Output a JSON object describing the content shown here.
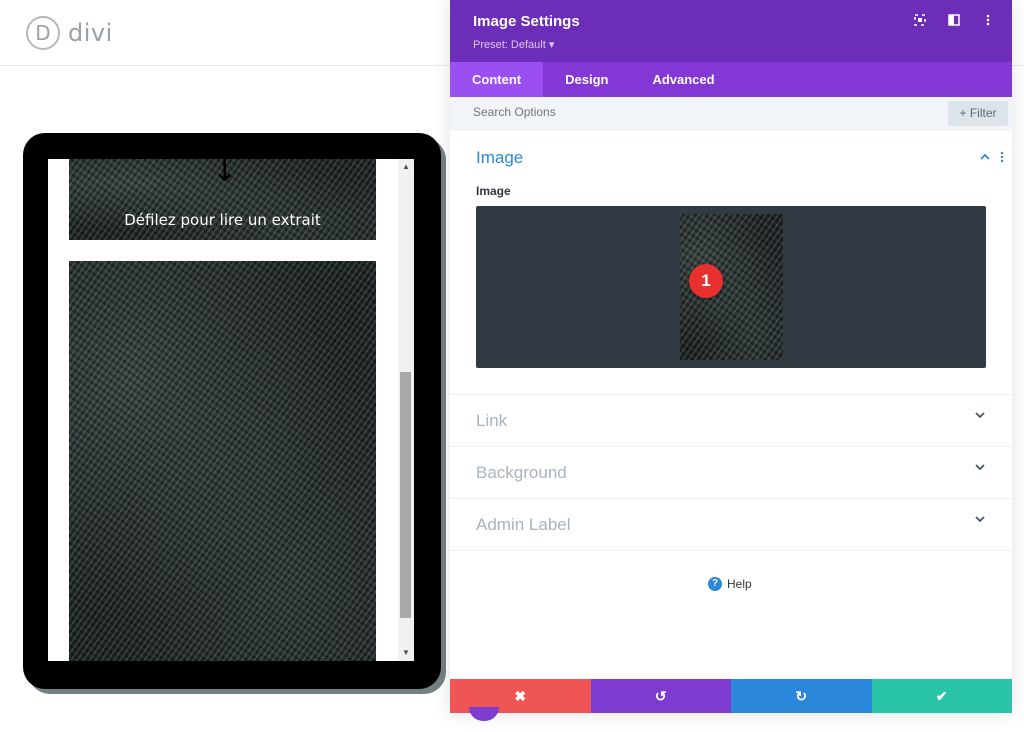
{
  "app": {
    "logo_text": "divi",
    "logo_mark": "D"
  },
  "preview": {
    "scroll_arrow_icon": "arrow-down-icon",
    "hero_text": "Défilez pour lire un extrait",
    "scrollbar_up": "▲",
    "scrollbar_down": "▼"
  },
  "panel": {
    "title": "Image Settings",
    "preset": "Preset: Default ▾",
    "header_icons": [
      "screenshot-icon",
      "sidebar-toggle-icon",
      "more-icon"
    ],
    "tabs": [
      {
        "label": "Content",
        "active": true
      },
      {
        "label": "Design",
        "active": false
      },
      {
        "label": "Advanced",
        "active": false
      }
    ],
    "search": {
      "placeholder": "Search Options"
    },
    "filter_label": "+ Filter",
    "image_section": {
      "title": "Image",
      "field_label": "Image",
      "badge": "1"
    },
    "collapsed_sections": [
      {
        "label": "Link"
      },
      {
        "label": "Background"
      },
      {
        "label": "Admin Label"
      }
    ],
    "help_label": "Help"
  },
  "footer": {
    "cancel": "✖",
    "undo": "↺",
    "redo": "↻",
    "save": "✔"
  },
  "colors": {
    "header": "#6c2eb9",
    "tabs": "#8338d6",
    "accent_blue": "#2b87da",
    "cancel": "#ef5555",
    "save": "#29c4a9"
  }
}
